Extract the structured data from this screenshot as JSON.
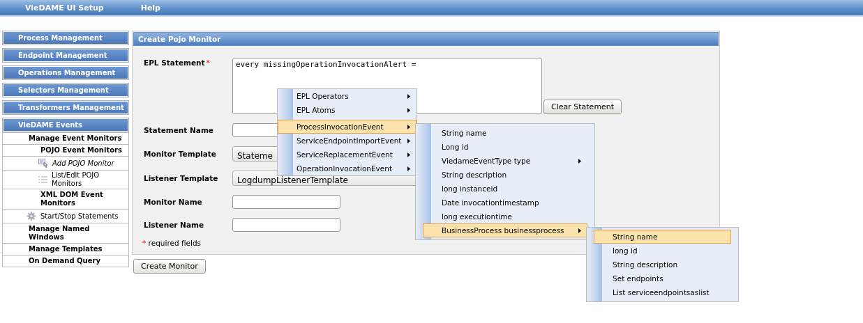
{
  "menu_bar": {
    "items": [
      "VieDAME UI Setup",
      "Help"
    ]
  },
  "sidebar": {
    "sections": [
      {
        "label": "Process Management"
      },
      {
        "label": "Endpoint Management"
      },
      {
        "label": "Operations Management"
      },
      {
        "label": "Selectors Management"
      },
      {
        "label": "Transformers Management"
      },
      {
        "label": "VieDAME Events",
        "children": [
          {
            "label": "Manage Event Monitors",
            "kind": "group",
            "children": [
              {
                "label": "POJO Event Monitors",
                "kind": "group",
                "children": [
                  {
                    "label": "Add POJO Monitor",
                    "kind": "add",
                    "selected": true
                  },
                  {
                    "label": "List/Edit POJO Monitors",
                    "kind": "list",
                    "selected": false
                  }
                ]
              },
              {
                "label": "XML DOM Event Monitors",
                "kind": "group"
              },
              {
                "label": "Start/Stop Statements",
                "kind": "tool",
                "selected": false
              }
            ]
          },
          {
            "label": "Manage Named Windows",
            "kind": "group"
          },
          {
            "label": "Manage Templates",
            "kind": "group"
          },
          {
            "label": "On Demand Query",
            "kind": "group"
          }
        ]
      }
    ]
  },
  "panel": {
    "title": "Create Pojo Monitor",
    "fields": [
      {
        "label": "EPL Statement",
        "kind": "textarea",
        "required": true,
        "value": "every missingOperationInvocationAlert =",
        "action": "Clear Statement"
      },
      {
        "label": "Statement Name",
        "kind": "text",
        "required": false
      },
      {
        "label": "Monitor Template",
        "kind": "select",
        "required": false,
        "value": "Stateme"
      },
      {
        "label": "Listener Template",
        "kind": "select",
        "required": false,
        "value": "LogdumpListenerTemplate"
      },
      {
        "label": "Monitor Name",
        "kind": "text",
        "required": false
      },
      {
        "label": "Listener Name",
        "kind": "text",
        "required": false
      }
    ],
    "required_mark": "*",
    "required_note": "required fields"
  },
  "submit_button": "Create Monitor",
  "context_menu": {
    "items": [
      {
        "label": "EPL Operators",
        "submenu": true,
        "selected": false,
        "divider_before": false
      },
      {
        "label": "EPL Atoms",
        "submenu": true,
        "selected": false,
        "divider_before": false
      },
      {
        "label": "ProcessInvocationEvent",
        "submenu": true,
        "selected": true,
        "divider_before": true,
        "children": [
          {
            "label": "String name",
            "submenu": false,
            "selected": false
          },
          {
            "label": "Long id",
            "submenu": false,
            "selected": false
          },
          {
            "label": "ViedameEventType type",
            "submenu": true,
            "selected": false
          },
          {
            "label": "String description",
            "submenu": false,
            "selected": false
          },
          {
            "label": "long instanceid",
            "submenu": false,
            "selected": false
          },
          {
            "label": "Date invocationtimestamp",
            "submenu": false,
            "selected": false
          },
          {
            "label": "long executiontime",
            "submenu": false,
            "selected": false
          },
          {
            "label": "BusinessProcess businessprocess",
            "submenu": true,
            "selected": true,
            "children": [
              {
                "label": "String name",
                "submenu": false,
                "selected": true
              },
              {
                "label": "long id",
                "submenu": false,
                "selected": false
              },
              {
                "label": "String description",
                "submenu": false,
                "selected": false
              },
              {
                "label": "Set endpoints",
                "submenu": false,
                "selected": false
              },
              {
                "label": "List serviceendpointsaslist",
                "submenu": false,
                "selected": false
              }
            ]
          }
        ]
      },
      {
        "label": "ServiceEndpointImportEvent",
        "submenu": true,
        "selected": false,
        "divider_before": false
      },
      {
        "label": "ServiceReplacementEvent",
        "submenu": true,
        "selected": false,
        "divider_before": false
      },
      {
        "label": "OperationInvocationEvent",
        "submenu": true,
        "selected": false,
        "divider_before": false
      }
    ]
  }
}
